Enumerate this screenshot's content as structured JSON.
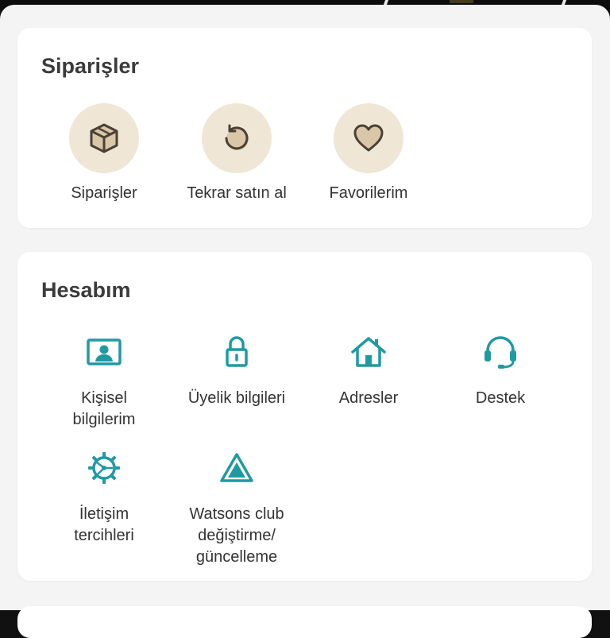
{
  "orders_section": {
    "title": "Siparişler",
    "items": [
      {
        "label": "Siparişler",
        "icon": "box-icon"
      },
      {
        "label": "Tekrar satın al",
        "icon": "reorder-icon"
      },
      {
        "label": "Favorilerim",
        "icon": "heart-icon"
      }
    ]
  },
  "account_section": {
    "title": "Hesabım",
    "items": [
      {
        "label": "Kişisel\nbilgilerim",
        "icon": "id-card-icon"
      },
      {
        "label": "Üyelik bilgileri",
        "icon": "lock-icon"
      },
      {
        "label": "Adresler",
        "icon": "home-icon"
      },
      {
        "label": "Destek",
        "icon": "headset-icon"
      },
      {
        "label": "İletişim\ntercihleri",
        "icon": "gear-icon"
      },
      {
        "label": "Watsons club\ndeğiştirme/\ngüncelleme",
        "icon": "watsons-club-icon"
      }
    ]
  },
  "colors": {
    "accent_teal": "#1f9aa3",
    "icon_circle_bg": "#efe6d6",
    "icon_dark": "#4a4036"
  }
}
